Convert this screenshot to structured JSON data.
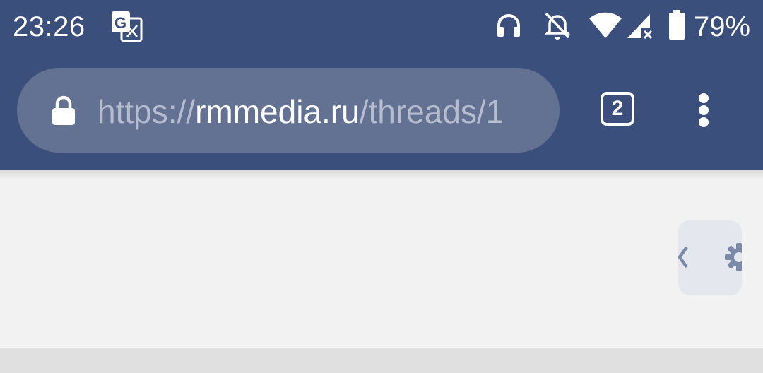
{
  "status_bar": {
    "time": "23:26",
    "notification_icon": "google-translate-icon",
    "icons": [
      "headphones-icon",
      "bell-off-icon",
      "wifi-icon",
      "signal-no-data-icon",
      "battery-icon"
    ],
    "battery_percent": "79%"
  },
  "browser": {
    "url": {
      "scheme": "https://",
      "domain": "rmmedia.ru",
      "path": "/threads/1"
    },
    "tab_count": "2",
    "menu_icon": "more-vert-icon"
  },
  "page": {
    "floating_widget_icons": [
      "chevron-left-icon",
      "gear-icon"
    ]
  },
  "colors": {
    "toolbar": "#3b4f7c",
    "url_bar": "#637293",
    "page_background": "#f2f2f2",
    "widget_background": "#e4e8ee",
    "widget_icon": "#7a8aa8"
  }
}
